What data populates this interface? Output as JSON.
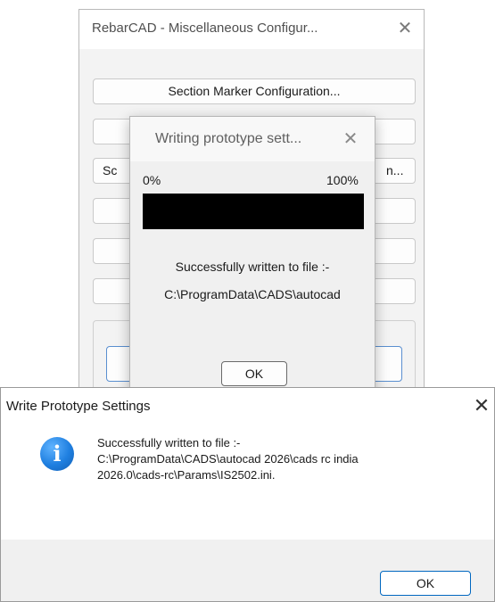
{
  "misc_dialog": {
    "title": "RebarCAD - Miscellaneous Configur...",
    "close_glyph": "✕",
    "buttons": [
      {
        "label": "Section Marker Configuration..."
      },
      {
        "label": ""
      },
      {
        "label_left": "Sc",
        "label_right": "n..."
      },
      {
        "label": ""
      },
      {
        "label": ""
      },
      {
        "label": ""
      }
    ]
  },
  "progress_dialog": {
    "title": "Writing prototype sett...",
    "close_glyph": "✕",
    "min_label": "0%",
    "max_label": "100%",
    "progress": 1.0,
    "progress_color": "#000000",
    "message_line1": "Successfully written to file :-",
    "message_line2": "C:\\ProgramData\\CADS\\autocad",
    "ok_label": "OK"
  },
  "message_box": {
    "title": "Write Prototype Settings",
    "close_glyph": "✕",
    "icon": "info-icon",
    "icon_glyph": "i",
    "icon_color": "#1f7fe0",
    "lines": [
      "Successfully written to file :-",
      "C:\\ProgramData\\CADS\\autocad 2026\\cads rc india",
      "2026.0\\cads-rc\\Params\\IS2502.ini."
    ],
    "ok_label": "OK",
    "accent": "#0067c0"
  }
}
